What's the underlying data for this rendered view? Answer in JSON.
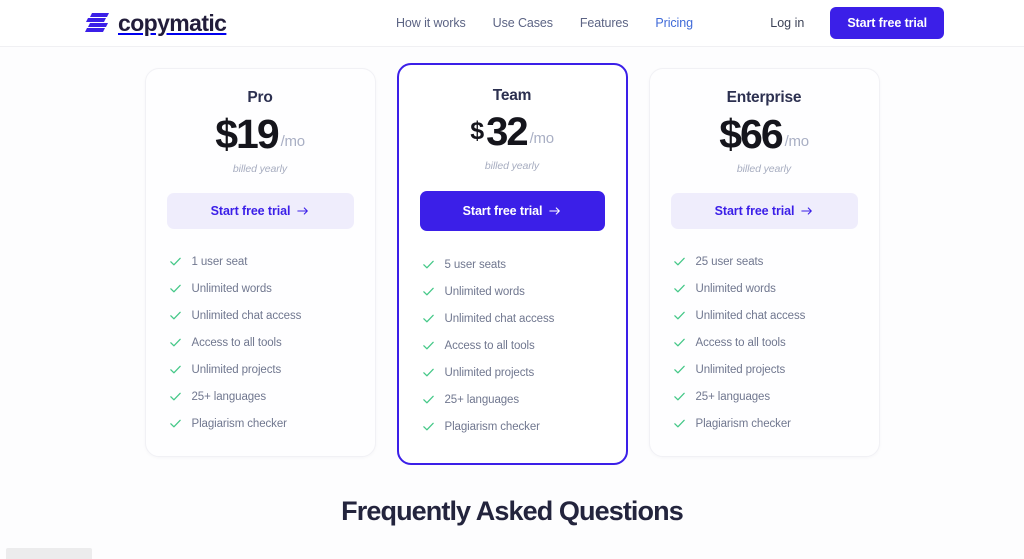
{
  "header": {
    "logo_icon": "copymatic-logo-icon",
    "logo_text": "copymatic",
    "nav": [
      {
        "label": "How it works",
        "active": false
      },
      {
        "label": "Use Cases",
        "active": false
      },
      {
        "label": "Features",
        "active": false
      },
      {
        "label": "Pricing",
        "active": true
      }
    ],
    "login_label": "Log in",
    "cta_label": "Start free trial"
  },
  "colors": {
    "brand_indigo": "#3b1fe8",
    "brand_indigo_soft": "#efedfc",
    "check_green": "#45c888",
    "nav_text": "#5c6484",
    "nav_active": "#3f6ad8",
    "heading_dark": "#23243d",
    "muted_text": "#70778f"
  },
  "plans": [
    {
      "name": "Pro",
      "currency": "$",
      "amount": "19",
      "period": "/mo",
      "billing_note": "billed yearly",
      "button_label": "Start free trial",
      "button_icon": "arrow-right-icon",
      "featured": false,
      "features": [
        "1 user seat",
        "Unlimited words",
        "Unlimited chat access",
        "Access to all tools",
        "Unlimited projects",
        "25+ languages",
        "Plagiarism checker"
      ]
    },
    {
      "name": "Team",
      "currency": "$",
      "amount": "32",
      "period": "/mo",
      "billing_note": "billed yearly",
      "button_label": "Start free trial",
      "button_icon": "arrow-right-icon",
      "featured": true,
      "features": [
        "5 user seats",
        "Unlimited words",
        "Unlimited chat access",
        "Access to all tools",
        "Unlimited projects",
        "25+ languages",
        "Plagiarism checker"
      ]
    },
    {
      "name": "Enterprise",
      "currency": "$",
      "amount": "66",
      "period": "/mo",
      "billing_note": "billed yearly",
      "button_label": "Start free trial",
      "button_icon": "arrow-right-icon",
      "featured": false,
      "features": [
        "25 user seats",
        "Unlimited words",
        "Unlimited chat access",
        "Access to all tools",
        "Unlimited projects",
        "25+ languages",
        "Plagiarism checker"
      ]
    }
  ],
  "faq": {
    "heading": "Frequently Asked Questions"
  }
}
